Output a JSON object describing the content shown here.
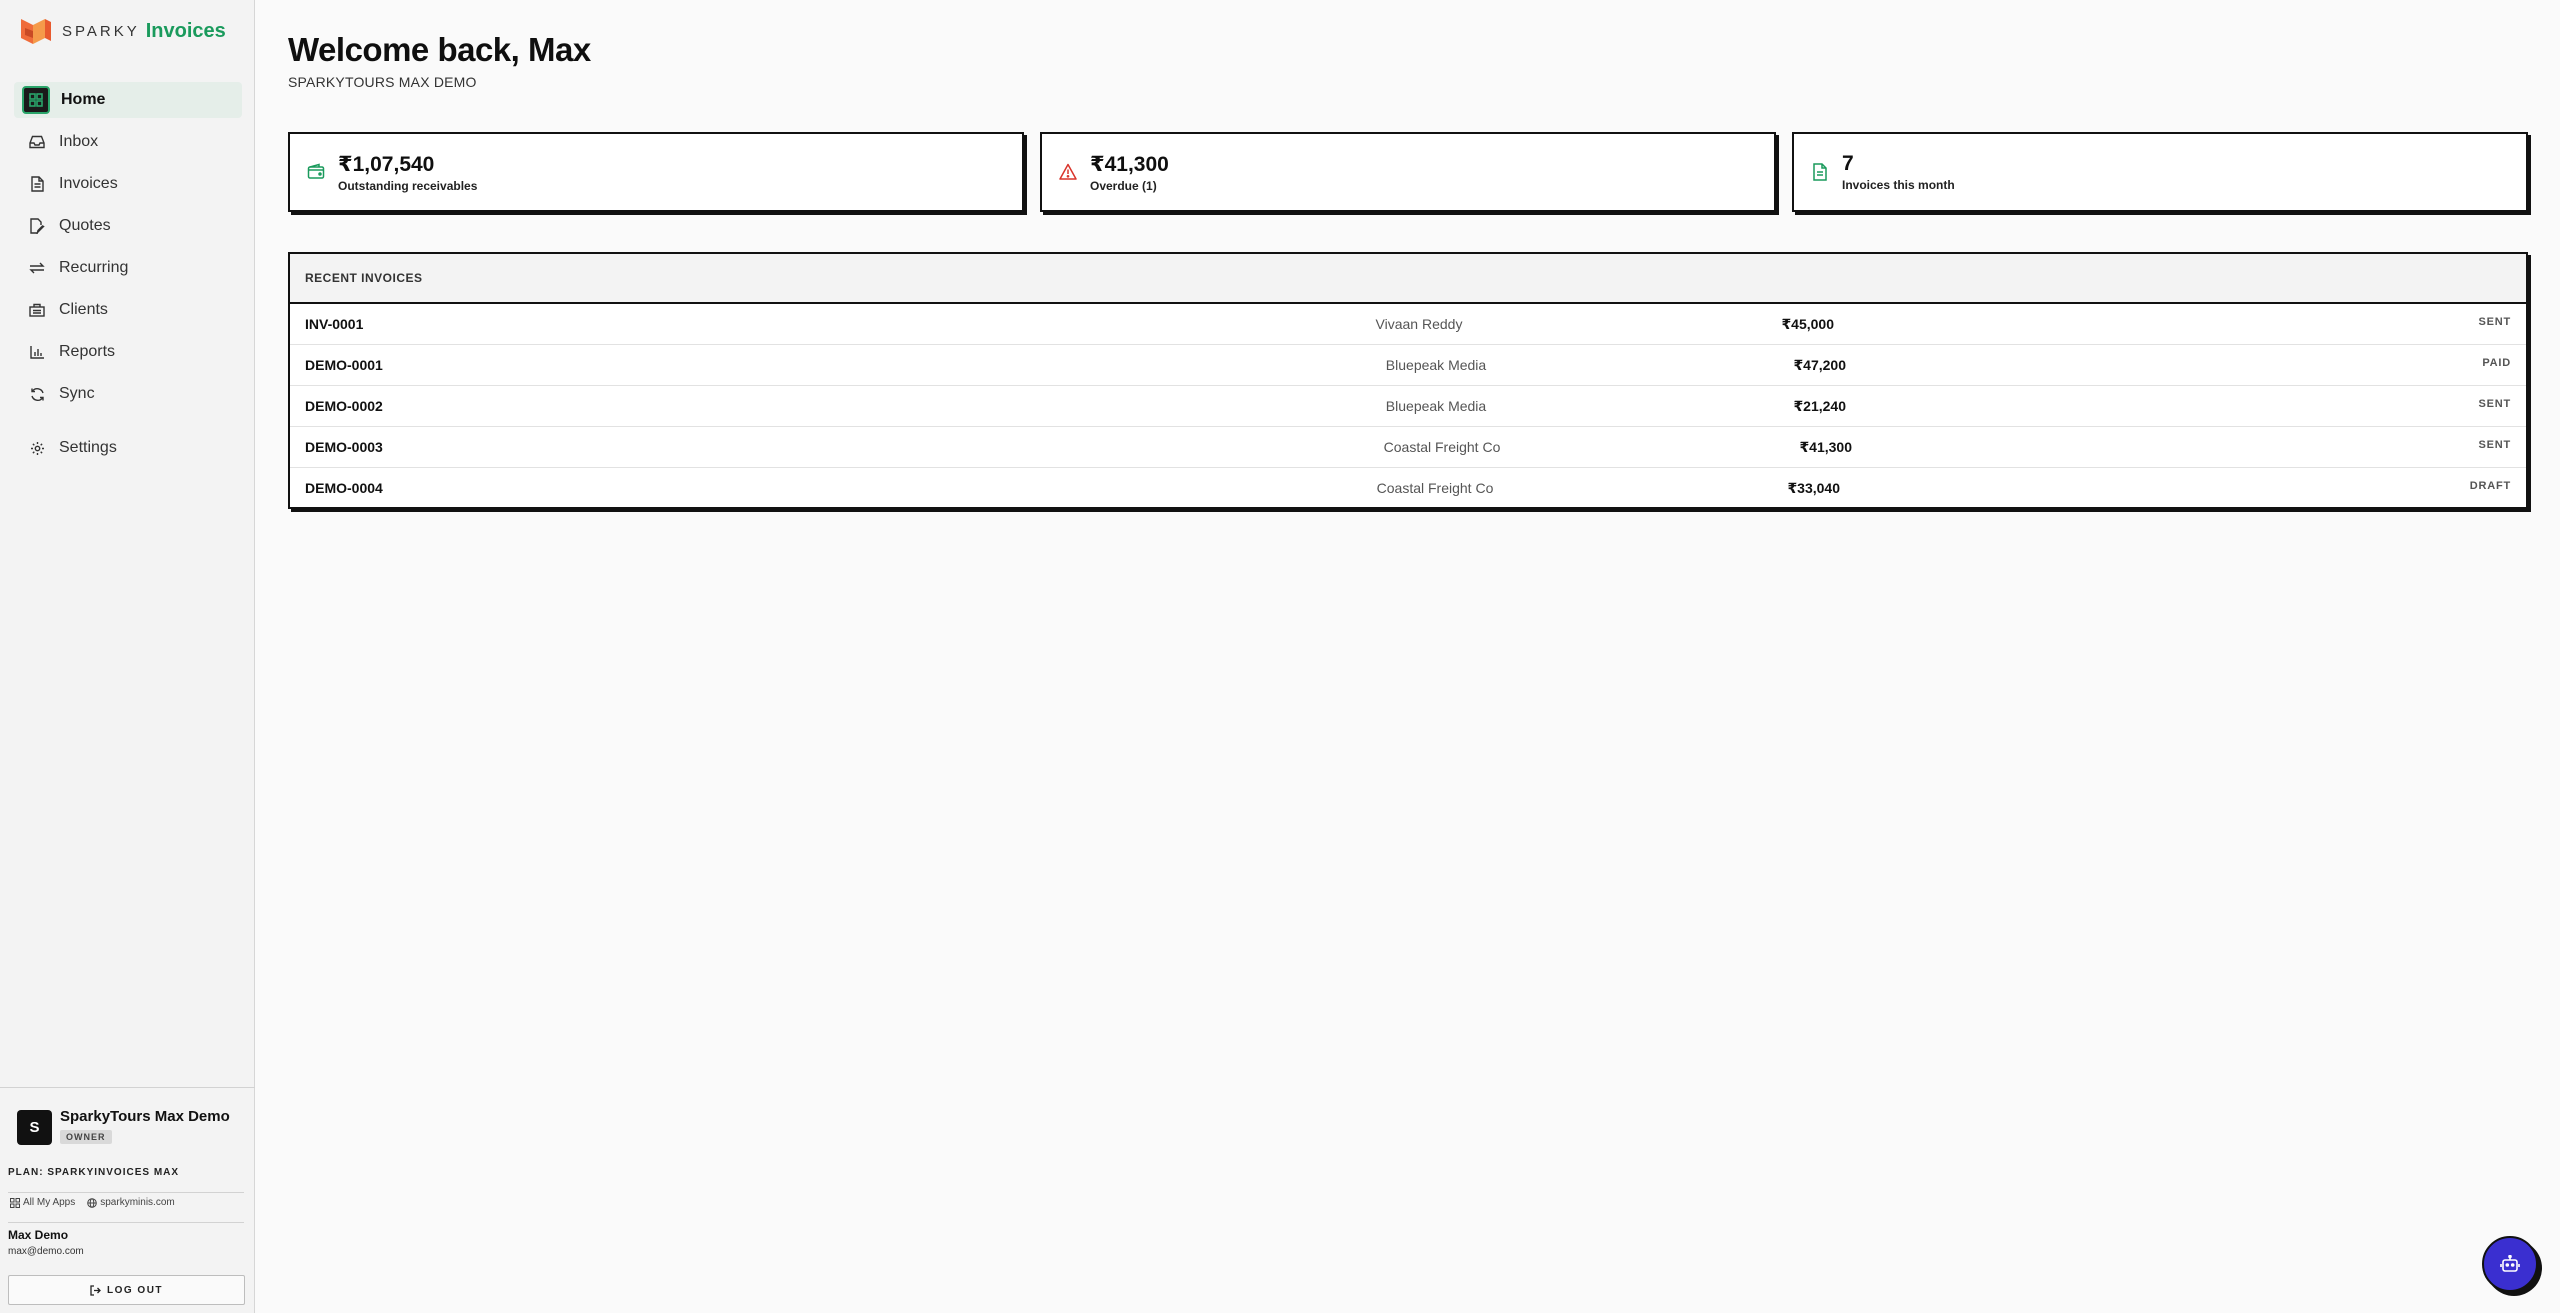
{
  "brand": {
    "sparky": "SPARKY",
    "product": "Invoices",
    "accent": "#1a9a5c"
  },
  "nav": [
    {
      "label": "Home",
      "icon": "dashboard-icon",
      "active": true
    },
    {
      "label": "Inbox",
      "icon": "inbox-icon"
    },
    {
      "label": "Invoices",
      "icon": "document-icon"
    },
    {
      "label": "Quotes",
      "icon": "quote-edit-icon"
    },
    {
      "label": "Recurring",
      "icon": "repeat-icon"
    },
    {
      "label": "Clients",
      "icon": "building-icon"
    },
    {
      "label": "Reports",
      "icon": "bar-chart-icon"
    },
    {
      "label": "Sync",
      "icon": "refresh-icon"
    },
    {
      "label": "Settings",
      "icon": "gear-icon"
    }
  ],
  "org": {
    "initial": "S",
    "name": "SparkyTours Max Demo",
    "role": "OWNER"
  },
  "plan": "PLAN: SPARKYINVOICES MAX",
  "links": {
    "apps": "All My Apps",
    "site": "sparkyminis.com"
  },
  "user": {
    "name": "Max Demo",
    "email": "max@demo.com"
  },
  "logout_label": "LOG OUT",
  "header": {
    "title": "Welcome back, Max",
    "subtitle": "SPARKYTOURS MAX DEMO"
  },
  "stats": [
    {
      "value": "₹1,07,540",
      "label": "Outstanding receivables",
      "icon": "wallet-icon",
      "color": "#1a9a5c"
    },
    {
      "value": "₹41,300",
      "label": "Overdue (1)",
      "icon": "warning-icon",
      "color": "#d9342b"
    },
    {
      "value": "7",
      "label": "Invoices this month",
      "icon": "document-icon",
      "color": "#1a9a5c"
    }
  ],
  "recent": {
    "title": "RECENT INVOICES",
    "rows": [
      {
        "id": "INV-0001",
        "client": "Vivaan Reddy",
        "amount": "₹45,000",
        "status": "SENT"
      },
      {
        "id": "DEMO-0001",
        "client": "Bluepeak Media",
        "amount": "₹47,200",
        "status": "PAID"
      },
      {
        "id": "DEMO-0002",
        "client": "Bluepeak Media",
        "amount": "₹21,240",
        "status": "SENT"
      },
      {
        "id": "DEMO-0003",
        "client": "Coastal Freight Co",
        "amount": "₹41,300",
        "status": "SENT"
      },
      {
        "id": "DEMO-0004",
        "client": "Coastal Freight Co",
        "amount": "₹33,040",
        "status": "DRAFT"
      }
    ]
  },
  "assistant": {
    "icon": "robot-icon",
    "color": "#3a2fd0"
  }
}
